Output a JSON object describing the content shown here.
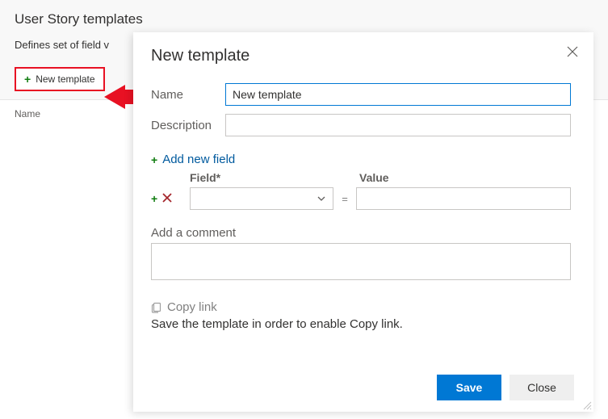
{
  "page": {
    "title": "User Story templates",
    "subtitle": "Defines set of field v",
    "newTemplateBtn": "New template",
    "nameColumn": "Name"
  },
  "dialog": {
    "title": "New template",
    "nameLabel": "Name",
    "nameValue": "New template",
    "descLabel": "Description",
    "descValue": "",
    "addFieldLink": "Add new field",
    "fieldHeader": "Field*",
    "valueHeader": "Value",
    "equals": "=",
    "commentLabel": "Add a comment",
    "commentValue": "",
    "copyLink": "Copy link",
    "copyNote": "Save the template in order to enable Copy link.",
    "saveBtn": "Save",
    "closeBtn": "Close"
  }
}
